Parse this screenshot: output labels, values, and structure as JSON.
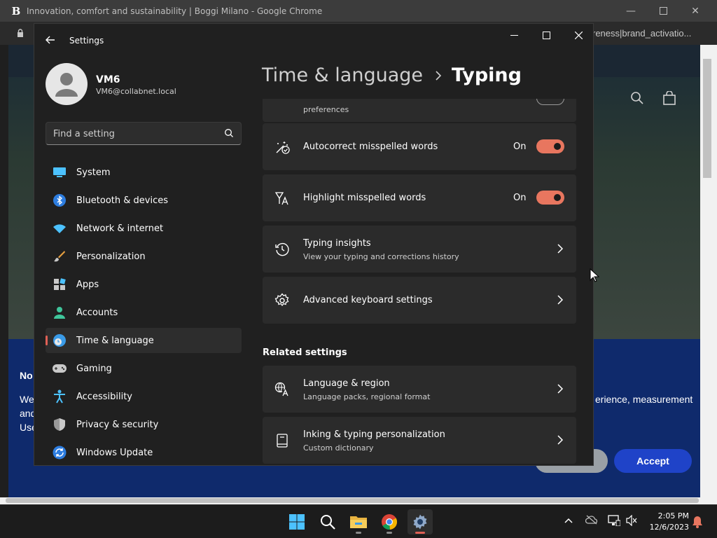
{
  "chrome": {
    "favicon": "B",
    "title": "Innovation, comfort and sustainability | Boggi Milano - Google Chrome",
    "url_fragment": "reness|brand_activatio...",
    "banner_heading": "No",
    "banner_line1": "We",
    "banner_line2": "and",
    "banner_line3": "Use",
    "banner_right_text": "erience, measurement",
    "accept_label": "Accept"
  },
  "settings": {
    "app_title": "Settings",
    "user": {
      "name": "VM6",
      "email": "VM6@collabnet.local"
    },
    "search": {
      "placeholder": "Find a setting"
    },
    "nav": [
      {
        "label": "System",
        "icon": "monitor-icon"
      },
      {
        "label": "Bluetooth & devices",
        "icon": "bluetooth-icon"
      },
      {
        "label": "Network & internet",
        "icon": "wifi-icon"
      },
      {
        "label": "Personalization",
        "icon": "brush-icon"
      },
      {
        "label": "Apps",
        "icon": "apps-icon"
      },
      {
        "label": "Accounts",
        "icon": "person-icon"
      },
      {
        "label": "Time & language",
        "icon": "globe-clock-icon",
        "active": true
      },
      {
        "label": "Gaming",
        "icon": "gamepad-icon"
      },
      {
        "label": "Accessibility",
        "icon": "accessibility-icon"
      },
      {
        "label": "Privacy & security",
        "icon": "shield-icon"
      },
      {
        "label": "Windows Update",
        "icon": "update-icon"
      }
    ],
    "breadcrumb": {
      "parent": "Time & language",
      "current": "Typing"
    },
    "cards": {
      "partial_subtitle": "preferences",
      "autocorrect": {
        "title": "Autocorrect misspelled words",
        "state": "On"
      },
      "highlight": {
        "title": "Highlight misspelled words",
        "state": "On"
      },
      "insights": {
        "title": "Typing insights",
        "subtitle": "View your typing and corrections history"
      },
      "advanced": {
        "title": "Advanced keyboard settings"
      }
    },
    "related": {
      "heading": "Related settings",
      "language": {
        "title": "Language & region",
        "subtitle": "Language packs, regional format"
      },
      "inking": {
        "title": "Inking & typing personalization",
        "subtitle": "Custom dictionary"
      }
    }
  },
  "taskbar": {
    "apps": [
      "start-icon",
      "search-icon",
      "file-explorer-icon",
      "chrome-icon",
      "settings-icon"
    ],
    "time": "2:05 PM",
    "date": "12/6/2023"
  },
  "colors": {
    "accent": "#e06055",
    "toggle_on": "#e8765f",
    "banner_blue": "#0f2a6c",
    "accept_blue": "#1f43c8"
  }
}
